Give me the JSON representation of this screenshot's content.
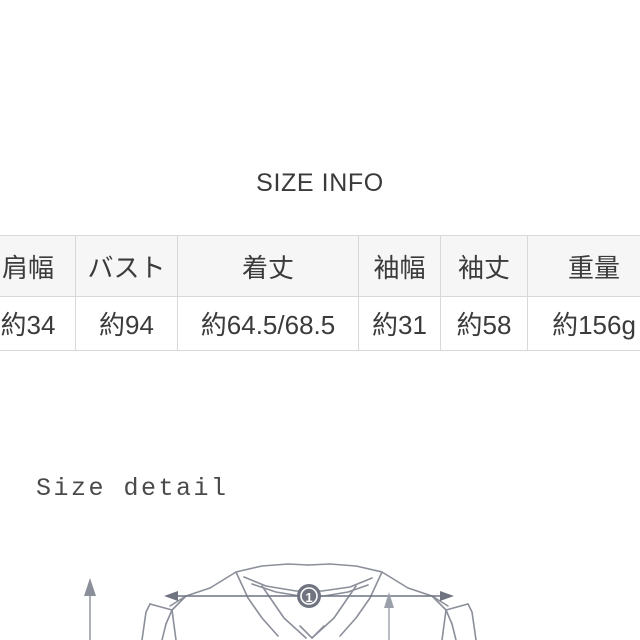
{
  "page": {
    "background_color": "#ffffff",
    "text_color": "#3b3b3b"
  },
  "section": {
    "title": "SIZE INFO"
  },
  "size_table": {
    "headers": [
      "肩幅",
      "バスト",
      "着丈",
      "袖幅",
      "袖丈",
      "重量"
    ],
    "rows": [
      [
        "約34",
        "約94",
        "約64.5/68.5",
        "約31",
        "約58",
        "約156g"
      ]
    ],
    "header_background": "#f6f6f6",
    "border_color": "#d8d8d8"
  },
  "size_detail": {
    "label": "Size detail",
    "diagram": {
      "subject": "shirt-collar-line-drawing",
      "line_color": "#8b8f99",
      "markers": [
        {
          "id": "1",
          "label": "1",
          "measure": "shoulder-width"
        }
      ],
      "arrows": [
        {
          "name": "shoulder-width-arrow",
          "orientation": "horizontal",
          "double_headed": true
        },
        {
          "name": "left-length-arrow",
          "orientation": "vertical",
          "double_headed": false
        },
        {
          "name": "right-length-arrow",
          "orientation": "vertical",
          "double_headed": false
        }
      ]
    }
  }
}
